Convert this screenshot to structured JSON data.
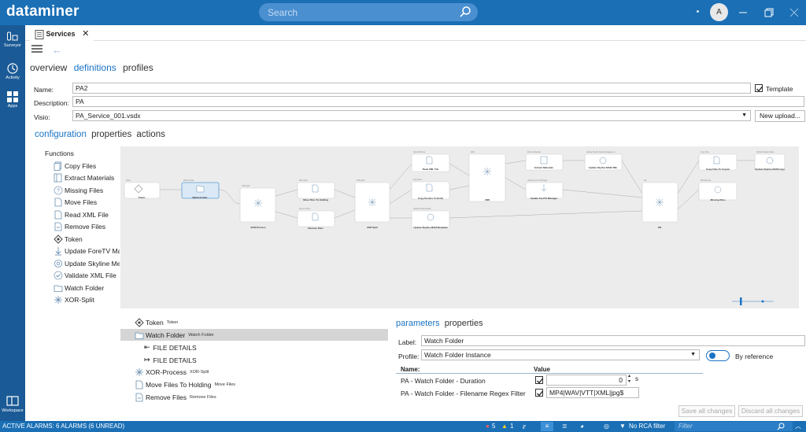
{
  "app": {
    "brand": "dataminer",
    "search_placeholder": "Search",
    "avatar_initial": "A"
  },
  "rail": {
    "items": [
      {
        "label": "Surveyor",
        "icon": "surveyor-icon"
      },
      {
        "label": "Activity",
        "icon": "activity-icon"
      },
      {
        "label": "Apps",
        "icon": "apps-icon"
      },
      {
        "label": "Workspace",
        "icon": "workspace-icon"
      }
    ]
  },
  "tab": {
    "label": "Services"
  },
  "navtabs": [
    "overview",
    "definitions",
    "profiles"
  ],
  "form": {
    "name_label": "Name:",
    "name_value": "PA2",
    "template_label": "Template",
    "description_label": "Description:",
    "description_value": "PA",
    "visio_label": "Visio:",
    "visio_value": "PA_Service_001.vsdx",
    "new_upload_label": "New upload..."
  },
  "subtabs": [
    "configuration",
    "properties",
    "actions"
  ],
  "functions": {
    "title": "Functions",
    "items": [
      {
        "label": "Copy Files",
        "icon": "copy-file-icon"
      },
      {
        "label": "Extract Materials",
        "icon": "extract-icon"
      },
      {
        "label": "Missing Files",
        "icon": "question-icon"
      },
      {
        "label": "Move Files",
        "icon": "file-icon"
      },
      {
        "label": "Read XML File",
        "icon": "file-icon"
      },
      {
        "label": "Remove Files",
        "icon": "remove-file-icon"
      },
      {
        "label": "Token",
        "icon": "token-icon"
      },
      {
        "label": "Update ForeTV Man",
        "icon": "download-icon"
      },
      {
        "label": "Update Skyline Med",
        "icon": "gear-network-icon"
      },
      {
        "label": "Validate XML File",
        "icon": "check-circle-icon"
      },
      {
        "label": "Watch Folder",
        "icon": "folder-icon"
      },
      {
        "label": "XOR-Split",
        "icon": "split-icon"
      }
    ]
  },
  "diagram": {
    "nodes": [
      {
        "label": "Token"
      },
      {
        "label": "Watch Folder"
      },
      {
        "label": "XOR-Process"
      },
      {
        "label": "Move Files To Holding"
      },
      {
        "label": "Remove Files"
      },
      {
        "label": "XOR Split"
      },
      {
        "label": "Read XML File"
      },
      {
        "label": "Copy Posters To Drobi"
      },
      {
        "label": "Update Skyline MAM Metadata"
      },
      {
        "label": "AND"
      },
      {
        "label": "Extract Materials"
      },
      {
        "label": "Update ForeTV Manager"
      },
      {
        "label": "Update Skyline MAM XML"
      },
      {
        "label": "OR"
      },
      {
        "label": "Copy Files To Cepols"
      },
      {
        "label": "Update Skyline MAM Copy"
      },
      {
        "label": "Missing Files"
      }
    ]
  },
  "tree": {
    "rows": [
      {
        "label": "Token",
        "sub": "Token",
        "icon": "token-icon"
      },
      {
        "label": "Watch Folder",
        "sub": "Watch Folder",
        "icon": "folder-icon",
        "selected": true
      },
      {
        "label": "FILE DETAILS",
        "icon": "arrow-in-icon",
        "indent": true
      },
      {
        "label": "FILE DETAILS",
        "icon": "arrow-out-icon",
        "indent": true
      },
      {
        "label": "XOR-Process",
        "sub": "XOR-Split",
        "icon": "split-icon"
      },
      {
        "label": "Move Files To Holding",
        "sub": "Move Files",
        "icon": "file-icon"
      },
      {
        "label": "Remove Files",
        "sub": "Remove Files",
        "icon": "remove-file-icon"
      }
    ]
  },
  "params": {
    "tabs": [
      "parameters",
      "properties"
    ],
    "label_label": "Label:",
    "label_value": "Watch Folder",
    "profile_label": "Profile:",
    "profile_value": "Watch Folder Instance",
    "by_reference_label": "By reference",
    "col_name": "Name:",
    "col_value": "Value",
    "rows": [
      {
        "name": "PA - Watch Folder - Duration",
        "value": "0",
        "unit": "s",
        "checked": true
      },
      {
        "name": "PA - Watch Folder - Filename Regex Filter",
        "value": "MP4|WAV|VTT|XML|jpg$",
        "checked": true
      }
    ],
    "save_label": "Save all changes",
    "discard_label": "Discard all changes"
  },
  "status": {
    "alarms_text": "ACTIVE ALARMS: 6 ALARMS (6 UNREAD)",
    "critical_count": "5",
    "warning_count": "1",
    "rca_label": "No RCA filter",
    "filter_placeholder": "Filter"
  },
  "colors": {
    "topbar": "#1a6fb5",
    "rail": "#1a5a96",
    "accent": "#1a73c5"
  }
}
